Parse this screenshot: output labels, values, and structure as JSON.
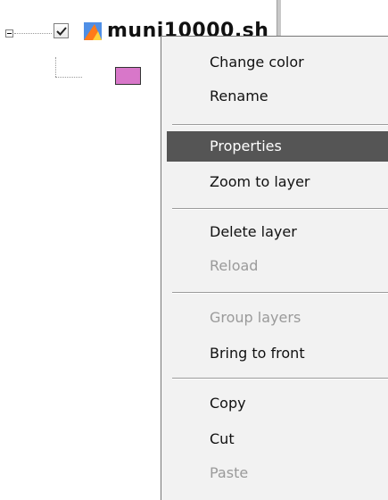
{
  "layer_tree": {
    "layer_name": "muni10000.sh",
    "checked": true,
    "legend_color": "#d877c9"
  },
  "context_menu": {
    "items": [
      {
        "label": "Change color",
        "enabled": true
      },
      {
        "label": "Rename",
        "enabled": true
      },
      {
        "label": "Properties",
        "enabled": true,
        "selected": true
      },
      {
        "label": "Zoom to layer",
        "enabled": true
      },
      {
        "label": "Delete layer",
        "enabled": true
      },
      {
        "label": "Reload",
        "enabled": false
      },
      {
        "label": "Group layers",
        "enabled": false
      },
      {
        "label": "Bring to front",
        "enabled": true
      },
      {
        "label": "Copy",
        "enabled": true
      },
      {
        "label": "Cut",
        "enabled": true
      },
      {
        "label": "Paste",
        "enabled": false
      }
    ]
  },
  "colors": {
    "menu_highlight": "#555555",
    "menu_background": "#f2f2f2",
    "disabled_text": "#9a9a9a"
  }
}
